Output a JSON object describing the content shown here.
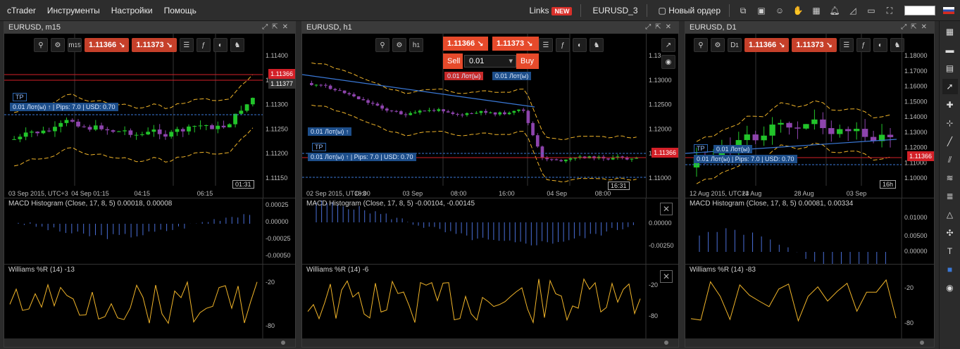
{
  "menu": {
    "app": "cTrader",
    "items": [
      "Инструменты",
      "Настройки",
      "Помощь"
    ]
  },
  "topbar": {
    "links": "Links",
    "badge": "NEW",
    "symbol": "EURUSD_3",
    "new_order": "Новый ордер"
  },
  "panels": [
    {
      "title": "EURUSD, m15",
      "tf": "15",
      "sell": "1.11366",
      "buy": "1.11373",
      "yticks": [
        "1.11400",
        "1.11350",
        "1.11300",
        "1.11250",
        "1.11200",
        "1.11150"
      ],
      "xticks": [
        "03 Sep 2015, UTC+3",
        "04 Sep 01:15",
        "04:15",
        "06:15"
      ],
      "cur_price": "1.11366",
      "top_price": "1.11377",
      "time_box": "01:31",
      "tp": "TP",
      "lot_line": "0.01 Лот(ы)",
      "lot_detail": "Pips: 7.0  |  USD: 0.70",
      "macd_label": "MACD Histogram (Close, 17, 8, 5) 0.00018, 0.00008",
      "macd_ticks": [
        "0.00025",
        "0.00000",
        "-0.00025",
        "-0.00050"
      ],
      "wpr_label": "Williams %R (14) -13",
      "wpr_ticks": [
        "-20",
        "-80"
      ]
    },
    {
      "title": "EURUSD, h1",
      "tf": "h",
      "sell": "1.11366",
      "buy": "1.11373",
      "sell_label": "Sell",
      "buy_label": "Buy",
      "qty": "0.01",
      "lot_red": "0.01 Лот(ы)",
      "lot_blue": "0.01 Лот(ы)",
      "yticks": [
        "1.13",
        "1.13000",
        "1.12500",
        "1.12000",
        "1.11500",
        "1.11000"
      ],
      "xticks": [
        "02 Sep 2015, UTC+3",
        "16:00",
        "03 Sep",
        "08:00",
        "16:00",
        "04 Sep",
        "08:00"
      ],
      "cur_price": "1.11366",
      "time_box": "16:31",
      "tp": "TP",
      "lot_line": "0.01 Лот(ы)",
      "lot_line2": "0.01 Лот(ы)",
      "lot_detail": "Pips: 7.0  |  USD: 0.70",
      "macd_label": "MACD Histogram (Close, 17, 8, 5) -0.00104, -0.00145",
      "macd_ticks": [
        "0.00000",
        "-0.00250"
      ],
      "wpr_label": "Williams %R (14) -6",
      "wpr_ticks": [
        "-20",
        "-80"
      ]
    },
    {
      "title": "EURUSD, D1",
      "tf": "D",
      "sell": "1.11366",
      "buy": "1.11373",
      "yticks": [
        "1.18000",
        "1.17000",
        "1.16000",
        "1.15000",
        "1.14000",
        "1.13000",
        "1.12000",
        "1.11000",
        "1.10000"
      ],
      "xticks": [
        "12 Aug 2015, UTC+3",
        "24 Aug",
        "28 Aug",
        "03 Sep"
      ],
      "cur_price": "1.11366",
      "time_box": "16h",
      "tp": "TP",
      "lot_line": "0.01 Лот(ы)",
      "lot_detail": "0.01 Лот(ы)  |  Pips: 7.0  |  USD: 0.70",
      "macd_label": "MACD Histogram (Close, 17, 8, 5) 0.00081, 0.00334",
      "macd_ticks": [
        "0.01000",
        "0.00500",
        "0.00000"
      ],
      "wpr_label": "Williams %R (14) -83",
      "wpr_ticks": [
        "-20",
        "-80"
      ]
    }
  ],
  "colors": {
    "bull": "#22c42a",
    "bear": "#8e44ad",
    "env": "#f0b429",
    "blue": "#3a78d6",
    "red": "#d32028",
    "wpr": "#f0b429"
  }
}
